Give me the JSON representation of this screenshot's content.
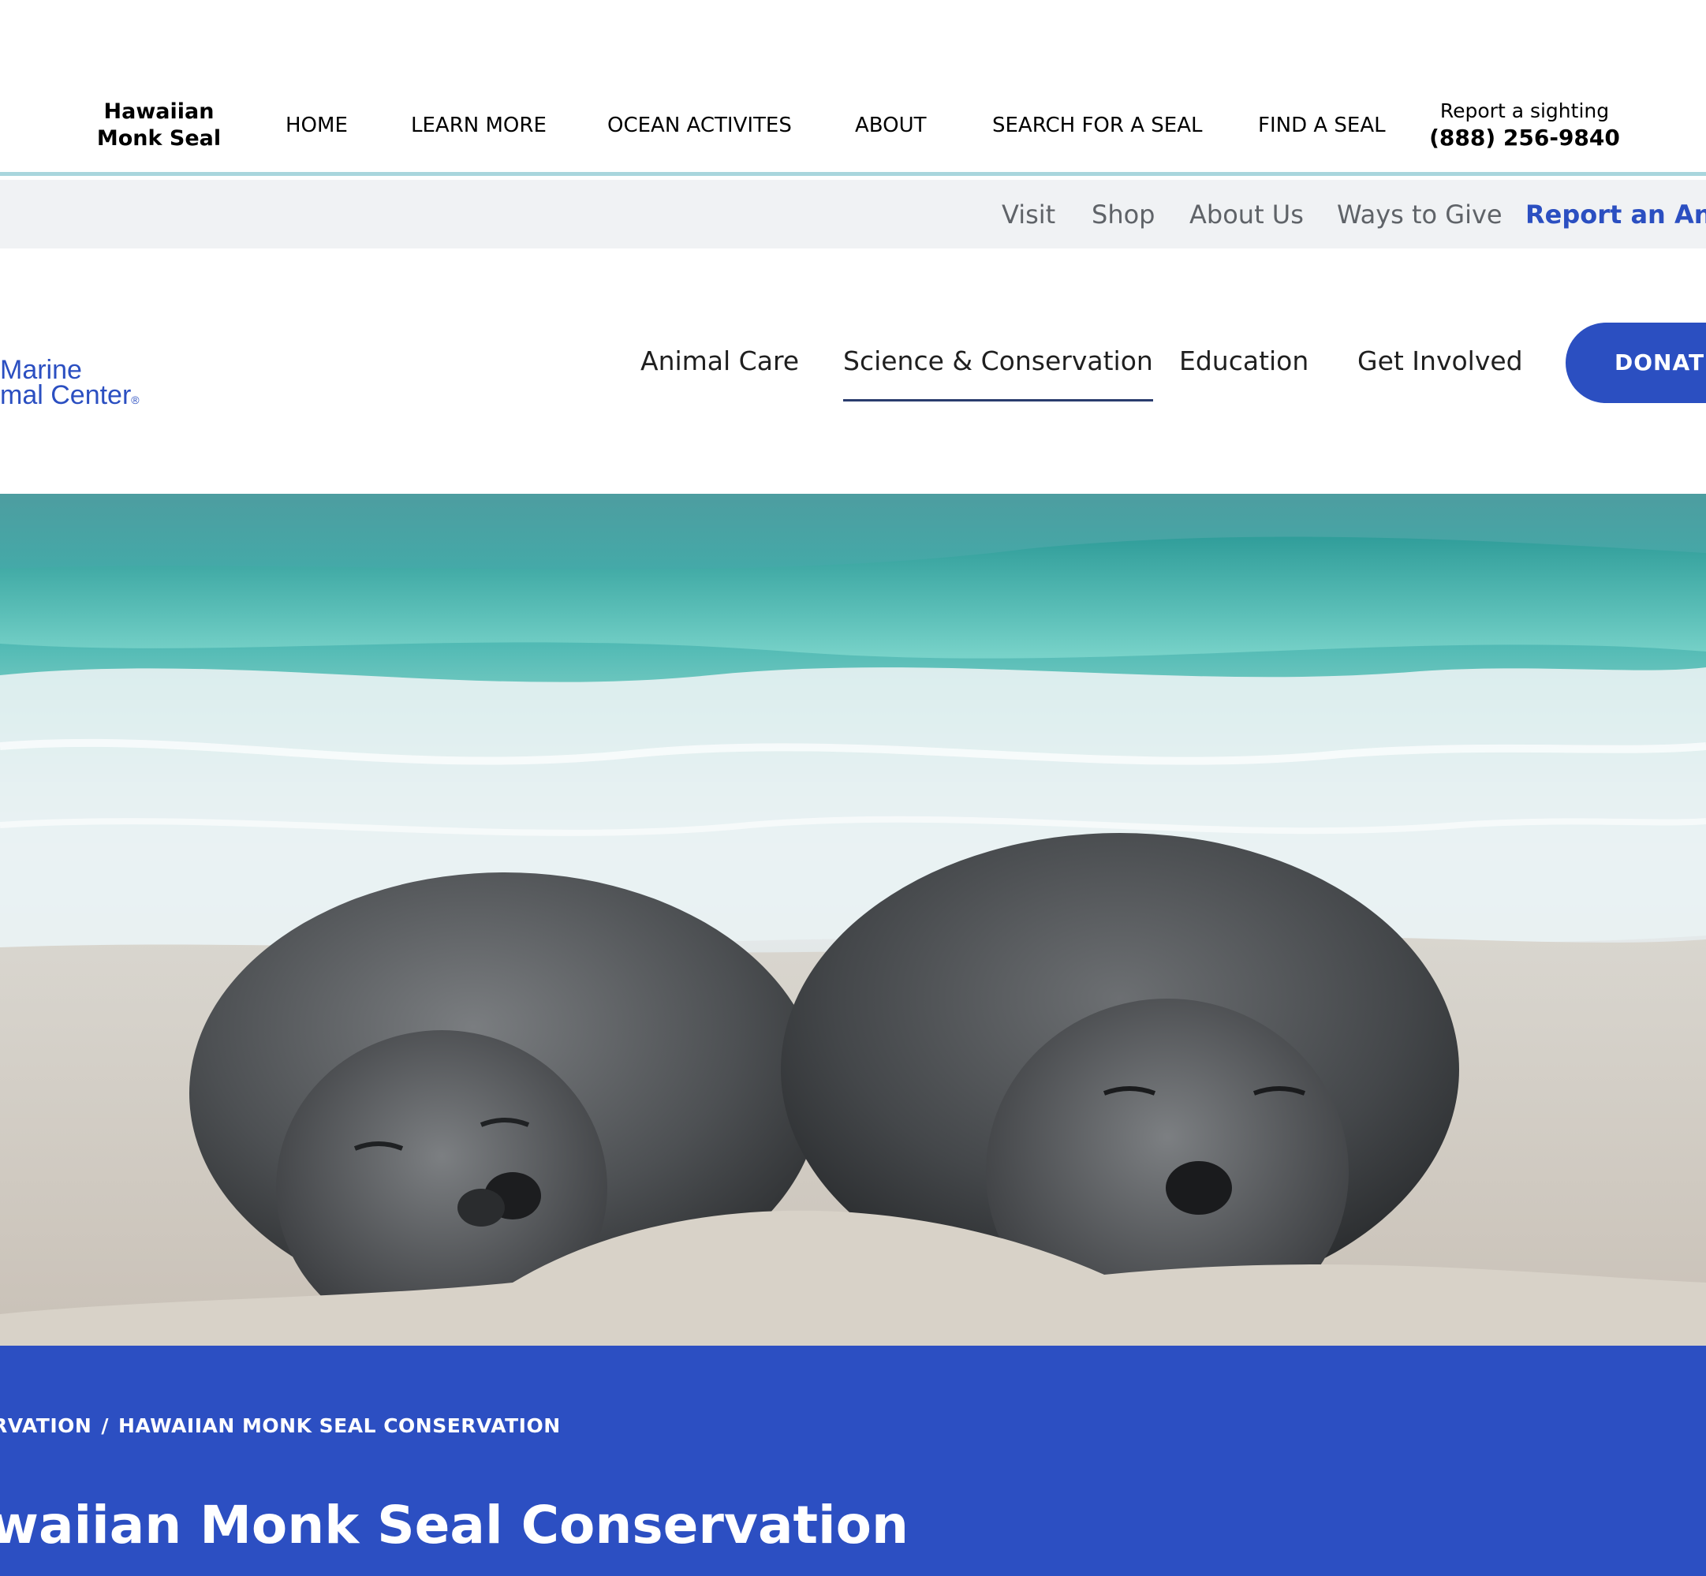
{
  "top_header": {
    "brand_line1": "Hawaiian",
    "brand_line2": "Monk Seal",
    "nav": [
      "HOME",
      "LEARN MORE",
      "OCEAN ACTIVITES",
      "ABOUT",
      "SEARCH FOR A SEAL",
      "FIND A SEAL"
    ],
    "report_label": "Report a sighting",
    "report_phone": "(888) 256-9840"
  },
  "utility_bar": {
    "links": [
      "Visit",
      "Shop",
      "About Us",
      "Ways to Give",
      "Report an Anim"
    ]
  },
  "main_nav": {
    "logo_line1": "Marine",
    "logo_line2": "mal Center",
    "logo_reg": "®",
    "links": [
      "Animal Care",
      "Science & Conservation",
      "Education",
      "Get Involved"
    ],
    "active": "Science & Conservation",
    "donate_label": "DONATE"
  },
  "title_band": {
    "breadcrumb_parent": "RVATION",
    "breadcrumb_separator": "/",
    "breadcrumb_current": "HAWAIIAN MONK SEAL CONSERVATION",
    "page_title": "waiian Monk Seal Conservation"
  },
  "colors": {
    "brand_blue": "#2b4fc1",
    "header_rule": "#a9d6dd",
    "utility_bg": "#f0f2f4",
    "active_underline": "#2a3c6e"
  }
}
